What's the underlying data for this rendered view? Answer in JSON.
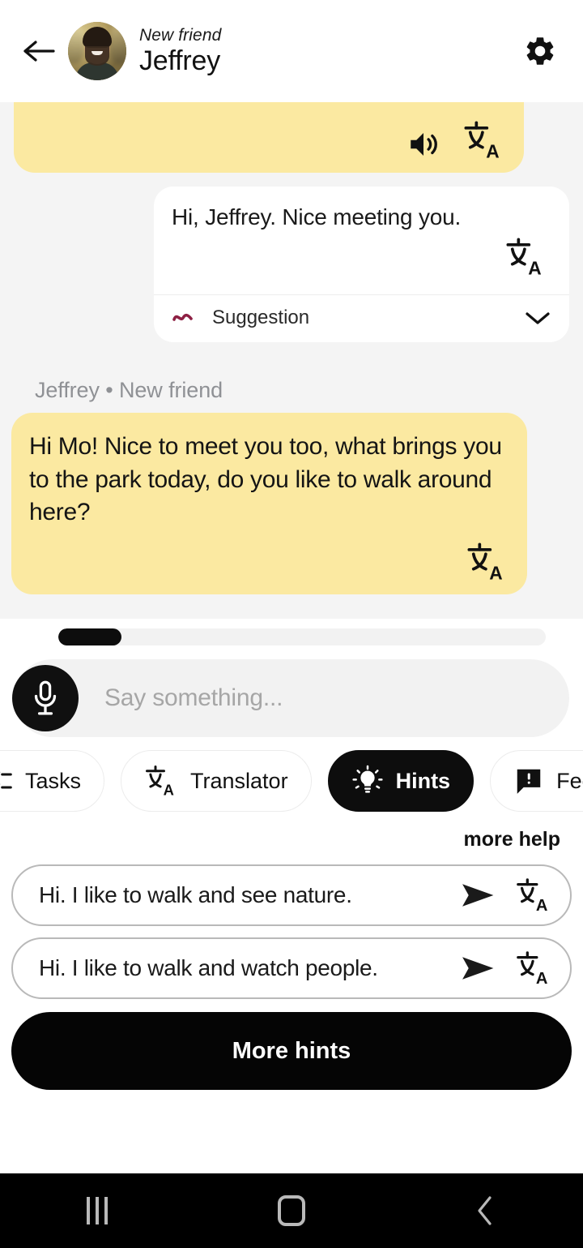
{
  "header": {
    "back_icon": "arrow-left-icon",
    "avatar_alt": "Jeffrey profile photo",
    "subtitle": "New friend",
    "title": "Jeffrey",
    "settings_icon": "gear-icon"
  },
  "chat": {
    "top_bubble": {
      "speaker_icon": "speaker-icon",
      "translate_icon": "translate-icon"
    },
    "outgoing_message": {
      "text": "Hi, Jeffrey. Nice meeting you.",
      "translate_icon": "translate-icon",
      "suggestion_label": "Suggestion",
      "suggestion_icon": "squiggle-icon",
      "expand_icon": "chevron-down-icon",
      "suggestion_color": "#8e2044"
    },
    "incoming_message": {
      "meta": "Jeffrey • New friend",
      "text": "Hi Mo! Nice to meet you too, what brings you to the park today, do you like to walk around here?",
      "translate_icon": "translate-icon"
    },
    "bubble_color_incoming": "#fbe9a1",
    "bubble_color_outgoing": "#ffffff",
    "background": "#f4f4f4"
  },
  "input": {
    "progress_percent": 13,
    "mic_icon": "microphone-icon",
    "placeholder": "Say something..."
  },
  "toolbar": {
    "items": [
      {
        "label": "Tasks",
        "icon": "tasks-icon",
        "active": false
      },
      {
        "label": "Translator",
        "icon": "translate-icon",
        "active": false
      },
      {
        "label": "Hints",
        "icon": "lightbulb-icon",
        "active": true
      },
      {
        "label": "Feedback",
        "icon": "feedback-icon",
        "active": false
      }
    ]
  },
  "hints": {
    "more_help_label": "more help",
    "suggestions": [
      {
        "text": "Hi. I like to walk and see nature.",
        "send_icon": "send-icon",
        "translate_icon": "translate-icon"
      },
      {
        "text": "Hi. I like to walk and watch people.",
        "send_icon": "send-icon",
        "translate_icon": "translate-icon"
      }
    ],
    "more_hints_label": "More hints"
  },
  "navbar": {
    "recents_icon": "recents-icon",
    "home_icon": "home-icon",
    "back_icon": "back-chevron-icon"
  }
}
